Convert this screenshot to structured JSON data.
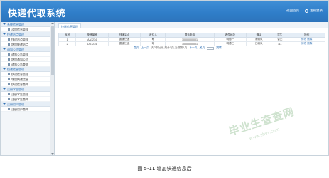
{
  "app": {
    "title": "快递代取系统"
  },
  "header": {
    "link_home": "返回首页",
    "link_logout": "注销登录"
  },
  "sidebar": {
    "groups": [
      {
        "title": "系统信息管理",
        "items": [
          "添加信息管理"
        ]
      },
      {
        "title": "快递站点管理",
        "items": [
          "快递站点管理",
          "增加快递站点"
        ]
      },
      {
        "title": "通知公告管理",
        "items": [
          "通知公告管理",
          "增加通知公告",
          "通知公告查询"
        ]
      },
      {
        "title": "快递信息管理",
        "items": [
          "快递信息管理",
          "增加快递信息",
          "快递信息查询"
        ]
      },
      {
        "title": "注册学生管理",
        "items": [
          "注册学生管理",
          "注册学生查询"
        ]
      },
      {
        "title": "注册用户管理",
        "items": [
          "注册用户查询"
        ]
      }
    ]
  },
  "tab": {
    "label": "快递信息管理"
  },
  "table": {
    "headers": [
      "序号",
      "快递单号",
      "快递站点",
      "收件人",
      "联系电话",
      "收件地址",
      "确认",
      "学生",
      "操作"
    ],
    "rows": [
      [
        "1",
        "AA1234",
        "圆通快递",
        "萌",
        "10000000001",
        "明德一",
        "未确认",
        "智无",
        "修改 删除"
      ],
      [
        "2",
        "DD1234",
        "圆通快递",
        "萌",
        "10000000001",
        "明德二",
        "已确认",
        "111",
        "修改 删除"
      ]
    ]
  },
  "pager": {
    "first": "首页",
    "prev": "上一页",
    "info": "共2条记录,共计1页,当前第1页",
    "next": "下一页",
    "last": "尾页",
    "goto": "跳转"
  },
  "watermark": {
    "text": "毕业生查查网",
    "url": "www.zbvv.com"
  },
  "caption": "图 5-11 增加快递信息后"
}
